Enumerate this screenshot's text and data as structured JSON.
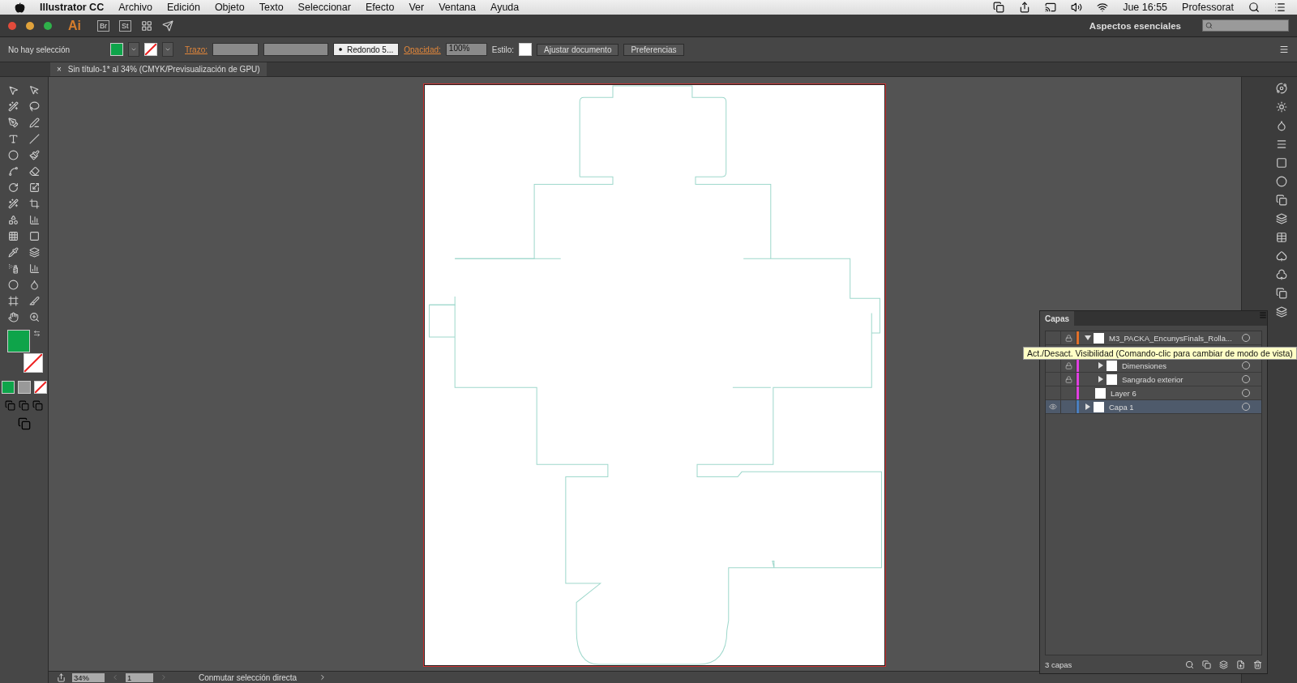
{
  "menu_bar": {
    "app_name": "Illustrator CC",
    "menus": [
      "Archivo",
      "Edición",
      "Objeto",
      "Texto",
      "Seleccionar",
      "Efecto",
      "Ver",
      "Ventana",
      "Ayuda"
    ],
    "clock": "Jue 16:55",
    "user": "Professorat"
  },
  "app_bar": {
    "logo": "Ai",
    "buttons": [
      "Br",
      "St"
    ],
    "workspace": "Aspectos esenciales"
  },
  "control_bar": {
    "selection": "No hay selección",
    "stroke_label": "Trazo:",
    "brush": "Redondo 5...",
    "opacity_label": "Opacidad:",
    "opacity": "100%",
    "style_label": "Estilo:",
    "buttons": [
      "Ajustar documento",
      "Preferencias"
    ]
  },
  "document_tab": {
    "close": "×",
    "title": "Sin título-1* al 34% (CMYK/Previsualización de GPU)"
  },
  "layers_panel": {
    "title": "Capas",
    "layers": [
      {
        "name": "M3_PACKA_EncunysFinals_Rolla...",
        "kind": "group",
        "expanded": true,
        "visible": false,
        "locked": true,
        "color": "#e0702a",
        "selected": false,
        "children": [
          {
            "kind": "covered"
          },
          {
            "name": "Dimensiones",
            "kind": "group",
            "expanded": false,
            "visible": false,
            "locked": true,
            "color": "#e040e0",
            "selected": false
          },
          {
            "name": "Sangrado exterior",
            "kind": "group",
            "expanded": false,
            "visible": false,
            "locked": true,
            "color": "#e040e0",
            "selected": false
          },
          {
            "name": "Layer 6",
            "kind": "plain",
            "visible": false,
            "locked": false,
            "color": "#e040e0",
            "selected": false
          }
        ]
      },
      {
        "name": "Capa 1",
        "kind": "group",
        "expanded": false,
        "visible": true,
        "locked": false,
        "color": "#4a7fc0",
        "selected": true
      }
    ],
    "count": "3 capas"
  },
  "tooltip": "Act./Desact. Visibilidad (Comando-clic para cambiar de modo de vista)",
  "status_bar": {
    "zoom": "34%",
    "artboard": "1",
    "status": "Conmutar selección directa"
  }
}
